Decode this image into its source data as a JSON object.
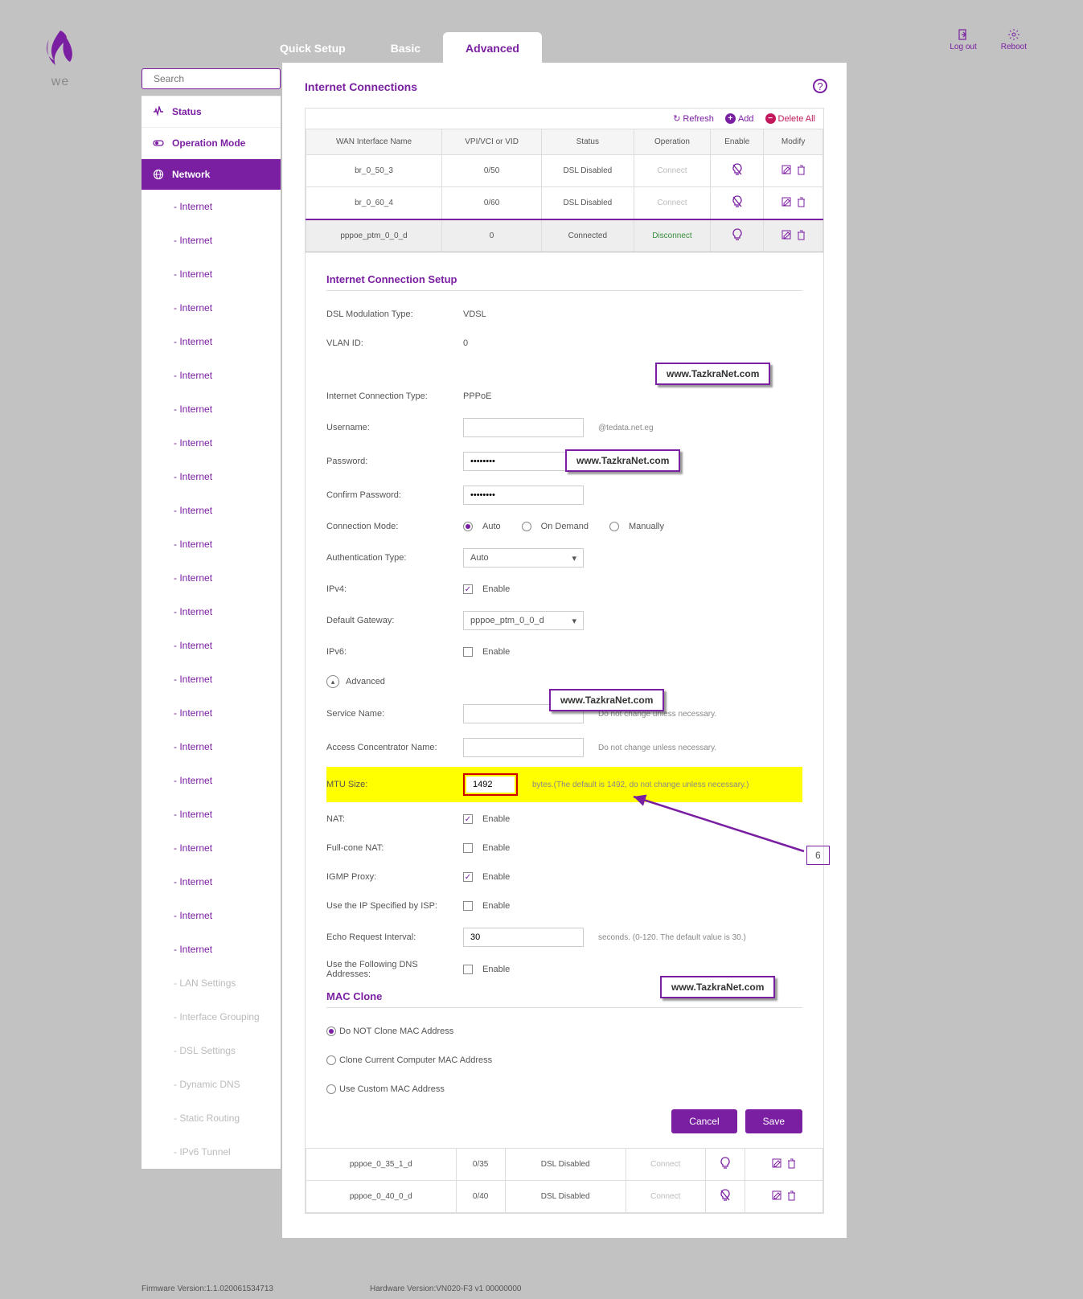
{
  "header": {
    "logout": "Log out",
    "reboot": "Reboot",
    "logo_text": "we"
  },
  "tabs": {
    "quick": "Quick Setup",
    "basic": "Basic",
    "advanced": "Advanced"
  },
  "search": {
    "placeholder": "Search"
  },
  "nav": {
    "status": "Status",
    "operation": "Operation Mode",
    "network": "Network",
    "subs": [
      "- Internet",
      "- Internet",
      "- Internet",
      "- Internet",
      "- Internet",
      "- Internet",
      "- Internet",
      "- Internet",
      "- Internet",
      "- Internet",
      "- Internet",
      "- Internet",
      "- Internet",
      "- Internet",
      "- Internet",
      "- Internet",
      "- Internet",
      "- Internet",
      "- Internet",
      "- Internet",
      "- Internet",
      "- Internet",
      "- Internet"
    ],
    "muted": [
      "- LAN Settings",
      "- Interface Grouping",
      "- DSL Settings",
      "- Dynamic DNS",
      "- Static Routing",
      "- IPv6 Tunnel"
    ]
  },
  "page": {
    "title": "Internet Connections"
  },
  "toolbar": {
    "refresh": "Refresh",
    "add": "Add",
    "delete_all": "Delete All"
  },
  "table": {
    "headers": [
      "WAN Interface Name",
      "VPI/VCI or VID",
      "Status",
      "Operation",
      "Enable",
      "Modify"
    ],
    "rows": [
      {
        "name": "br_0_50_3",
        "vid": "0/50",
        "status": "DSL Disabled",
        "op": "Connect",
        "enabled": false,
        "selected": false
      },
      {
        "name": "br_0_60_4",
        "vid": "0/60",
        "status": "DSL Disabled",
        "op": "Connect",
        "enabled": false,
        "selected": false
      },
      {
        "name": "pppoe_ptm_0_0_d",
        "vid": "0",
        "status": "Connected",
        "op": "Disconnect",
        "enabled": true,
        "selected": true
      }
    ],
    "footer_rows": [
      {
        "name": "pppoe_0_35_1_d",
        "vid": "0/35",
        "status": "DSL Disabled",
        "op": "Connect",
        "enabled": true
      },
      {
        "name": "pppoe_0_40_0_d",
        "vid": "0/40",
        "status": "DSL Disabled",
        "op": "Connect",
        "enabled": false
      }
    ]
  },
  "form": {
    "section1": "Internet Connection Setup",
    "dsl_mod_label": "DSL Modulation Type:",
    "dsl_mod_value": "VDSL",
    "vlan_label": "VLAN ID:",
    "vlan_value": "0",
    "conn_type_label": "Internet Connection Type:",
    "conn_type_value": "PPPoE",
    "user_label": "Username:",
    "user_suffix": "@tedata.net.eg",
    "pass_label": "Password:",
    "pass_value": "********",
    "confirm_label": "Confirm Password:",
    "confirm_value": "********",
    "mode_label": "Connection Mode:",
    "mode_auto": "Auto",
    "mode_ondemand": "On Demand",
    "mode_manual": "Manually",
    "auth_label": "Authentication Type:",
    "auth_value": "Auto",
    "ipv4_label": "IPv4:",
    "enable_txt": "Enable",
    "gw_label": "Default Gateway:",
    "gw_value": "pppoe_ptm_0_0_d",
    "ipv6_label": "IPv6:",
    "advanced_toggle": "Advanced",
    "service_label": "Service Name:",
    "service_hint": "Do not change unless necessary.",
    "ac_label": "Access Concentrator Name:",
    "ac_hint": "Do not change unless necessary.",
    "mtu_label": "MTU Size:",
    "mtu_value": "1492",
    "mtu_hint": "bytes.(The default is 1492, do not change unless necessary.)",
    "nat_label": "NAT:",
    "fullcone_label": "Full-cone NAT:",
    "igmp_label": "IGMP Proxy:",
    "ispip_label": "Use the IP Specified by ISP:",
    "echo_label": "Echo Request Interval:",
    "echo_value": "30",
    "echo_hint": "seconds. (0-120. The default value is 30.)",
    "dns_label": "Use the Following DNS Addresses:",
    "mac_section": "MAC Clone",
    "mac_opt1": "Do NOT Clone MAC Address",
    "mac_opt2": "Clone Current Computer MAC Address",
    "mac_opt3": "Use Custom MAC Address",
    "cancel": "Cancel",
    "save": "Save"
  },
  "overlays": {
    "watermark": "www.TazkraNet.com",
    "callout_num": "6"
  },
  "footer": {
    "fw": "Firmware Version:1.1.020061534713",
    "hw": "Hardware Version:VN020-F3 v1 00000000"
  }
}
